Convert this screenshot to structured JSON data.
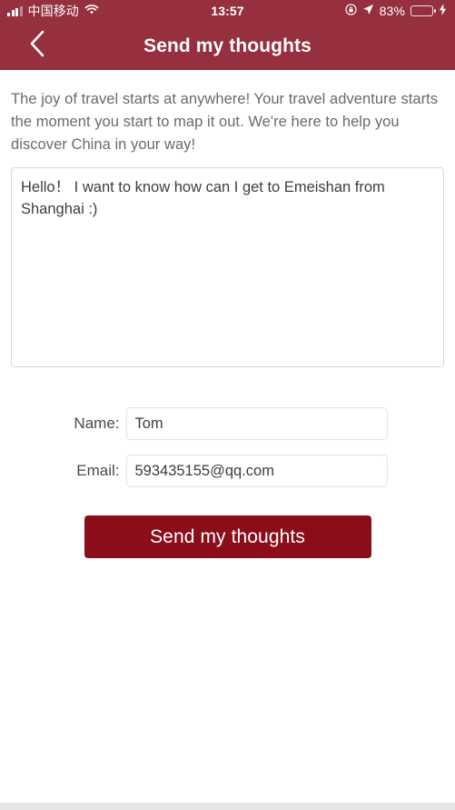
{
  "status_bar": {
    "carrier": "中国移动",
    "signal_icon": "signal-bars-icon",
    "wifi_icon": "wifi-icon",
    "time": "13:57",
    "rotation_lock_icon": "rotation-lock-icon",
    "location_icon": "location-arrow-icon",
    "battery_percent": "83%",
    "battery_level": 83,
    "battery_icon": "battery-icon",
    "charging_icon": "lightning-bolt-icon",
    "bar_color": "#962f3e"
  },
  "nav_bar": {
    "back_icon": "chevron-left-icon",
    "title": "Send my thoughts",
    "bar_color": "#962f3e"
  },
  "main": {
    "intro_text": "The joy of travel starts at anywhere! Your travel adventure starts the moment you start to map it out. We're here to help you discover China in your way!",
    "message": {
      "value": "Hello！ I want to know how can I get to Emeishan from Shanghai :)",
      "placeholder": ""
    },
    "form": {
      "fields": [
        {
          "label": "Name:",
          "value": "Tom",
          "placeholder": ""
        },
        {
          "label": "Email:",
          "value": "593435155@qq.com",
          "placeholder": ""
        }
      ]
    },
    "submit": {
      "label": "Send my thoughts",
      "color": "#8c0d1a"
    }
  }
}
